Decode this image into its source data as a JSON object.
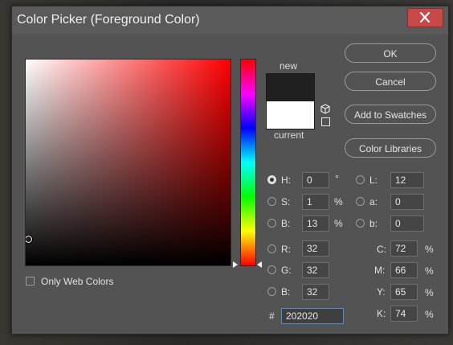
{
  "window": {
    "title": "Color Picker (Foreground Color)"
  },
  "swatches": {
    "new_label": "new",
    "current_label": "current",
    "new_color": "#202020",
    "current_color": "#ffffff"
  },
  "buttons": {
    "ok": "OK",
    "cancel": "Cancel",
    "add_to_swatches": "Add to Swatches",
    "color_libraries": "Color Libraries"
  },
  "hsb": {
    "h": {
      "label": "H:",
      "value": "0",
      "unit": "°"
    },
    "s": {
      "label": "S:",
      "value": "1",
      "unit": "%"
    },
    "b": {
      "label": "B:",
      "value": "13",
      "unit": "%"
    }
  },
  "rgb": {
    "r": {
      "label": "R:",
      "value": "32"
    },
    "g": {
      "label": "G:",
      "value": "32"
    },
    "b": {
      "label": "B:",
      "value": "32"
    }
  },
  "lab": {
    "l": {
      "label": "L:",
      "value": "12"
    },
    "a": {
      "label": "a:",
      "value": "0"
    },
    "b": {
      "label": "b:",
      "value": "0"
    }
  },
  "cmyk": {
    "c": {
      "label": "C:",
      "value": "72",
      "unit": "%"
    },
    "m": {
      "label": "M:",
      "value": "66",
      "unit": "%"
    },
    "y": {
      "label": "Y:",
      "value": "65",
      "unit": "%"
    },
    "k": {
      "label": "K:",
      "value": "74",
      "unit": "%"
    }
  },
  "hex": {
    "label": "#",
    "value": "202020"
  },
  "options": {
    "only_web_colors": "Only Web Colors"
  },
  "selection": {
    "hue": 0,
    "saturation": 1,
    "brightness": 13
  },
  "colors": {
    "accent": "#4a90d9",
    "close": "#c74846"
  }
}
